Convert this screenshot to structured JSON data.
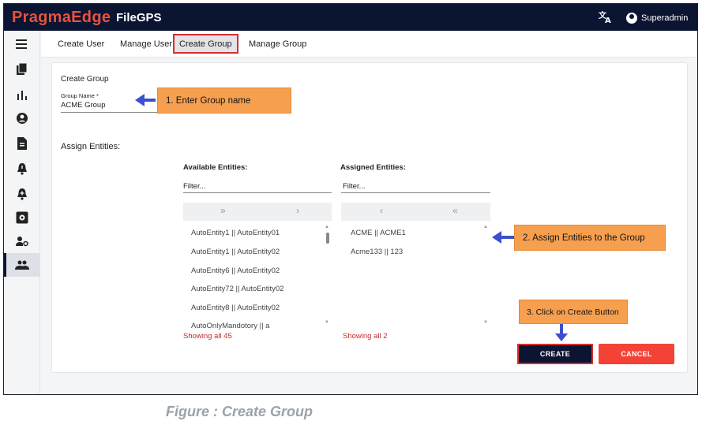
{
  "app": {
    "brand": "PragmaEdge",
    "brand_product": "FileGPS",
    "user_name": "Superadmin"
  },
  "tabs": [
    "Create User",
    "Manage User",
    "Create Group",
    "Manage Group"
  ],
  "active_tab": "Create Group",
  "form": {
    "section_title": "Create Group",
    "group_name_label": "Group Name *",
    "group_name_value": "ACME Group",
    "assign_label": "Assign Entities:"
  },
  "available": {
    "header": "Available Entities:",
    "filter_placeholder": "Filter...",
    "move_all": "»",
    "move_one": "›",
    "items": [
      "AutoEntity1 || AutoEntity01",
      "AutoEntity1 || AutoEntity02",
      "AutoEntity6 || AutoEntity02",
      "AutoEntity72 || AutoEntity02",
      "AutoEntity8 || AutoEntity02",
      "AutoOnlyMandotory || a"
    ],
    "showing": "Showing all 45"
  },
  "assigned": {
    "header": "Assigned Entities:",
    "filter_placeholder": "Filter...",
    "remove_one": "‹",
    "remove_all": "«",
    "items": [
      "ACME || ACME1",
      "Acme133 || 123"
    ],
    "showing": "Showing all 2"
  },
  "buttons": {
    "create": "CREATE",
    "cancel": "CANCEL"
  },
  "callouts": {
    "step1": "1. Enter Group name",
    "step2": "2. Assign Entities to the Group",
    "step3": "3. Click on Create Button"
  },
  "caption": "Figure : Create Group",
  "colors": {
    "topbar": "#0b1431",
    "brand": "#e8523d",
    "create_button": "#0b1431",
    "cancel_button": "#f44336",
    "callout": "#f6a04f",
    "arrow": "#3d4fcf",
    "showing_text": "#c62828"
  }
}
